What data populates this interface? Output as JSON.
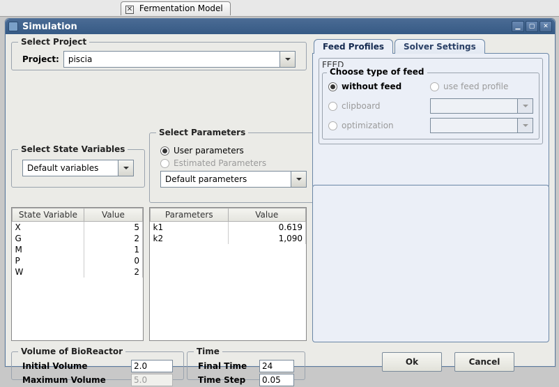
{
  "bgTab": {
    "label": "Fermentation Model"
  },
  "window": {
    "title": "Simulation"
  },
  "project": {
    "legend": "Select Project",
    "label": "Project:",
    "value": "piscia"
  },
  "ssv": {
    "legend": "Select State Variables",
    "value": "Default variables"
  },
  "sp": {
    "legend": "Select Parameters",
    "opt_user": "User parameters",
    "opt_est": "Estimated Parameters",
    "value": "Default parameters"
  },
  "svTable": {
    "headers": [
      "State Variable",
      "Value"
    ],
    "rows": [
      {
        "n": "X",
        "v": "5"
      },
      {
        "n": "G",
        "v": "2"
      },
      {
        "n": "M",
        "v": "1"
      },
      {
        "n": "P",
        "v": "0"
      },
      {
        "n": "W",
        "v": "2"
      }
    ]
  },
  "parTable": {
    "headers": [
      "Parameters",
      "Value"
    ],
    "rows": [
      {
        "n": "k1",
        "v": "0.619"
      },
      {
        "n": "k2",
        "v": "1,090"
      }
    ]
  },
  "vol": {
    "legend": "Volume of BioReactor",
    "initial_lbl": "Initial Volume",
    "initial_val": "2.0",
    "max_lbl": "Maximum Volume",
    "max_val": "5.0"
  },
  "time": {
    "legend": "Time",
    "final_lbl": "Final Time",
    "final_val": "24",
    "step_lbl": "Time Step",
    "step_val": "0.05"
  },
  "tabs": {
    "feed": "Feed Profiles",
    "solver": "Solver Settings"
  },
  "feed": {
    "group": "FEED",
    "choose": "Choose type of feed",
    "without": "without feed",
    "profile": "use feed profile",
    "clipboard": "clipboard",
    "optimization": "optimization"
  },
  "buttons": {
    "ok": "Ok",
    "cancel": "Cancel"
  }
}
